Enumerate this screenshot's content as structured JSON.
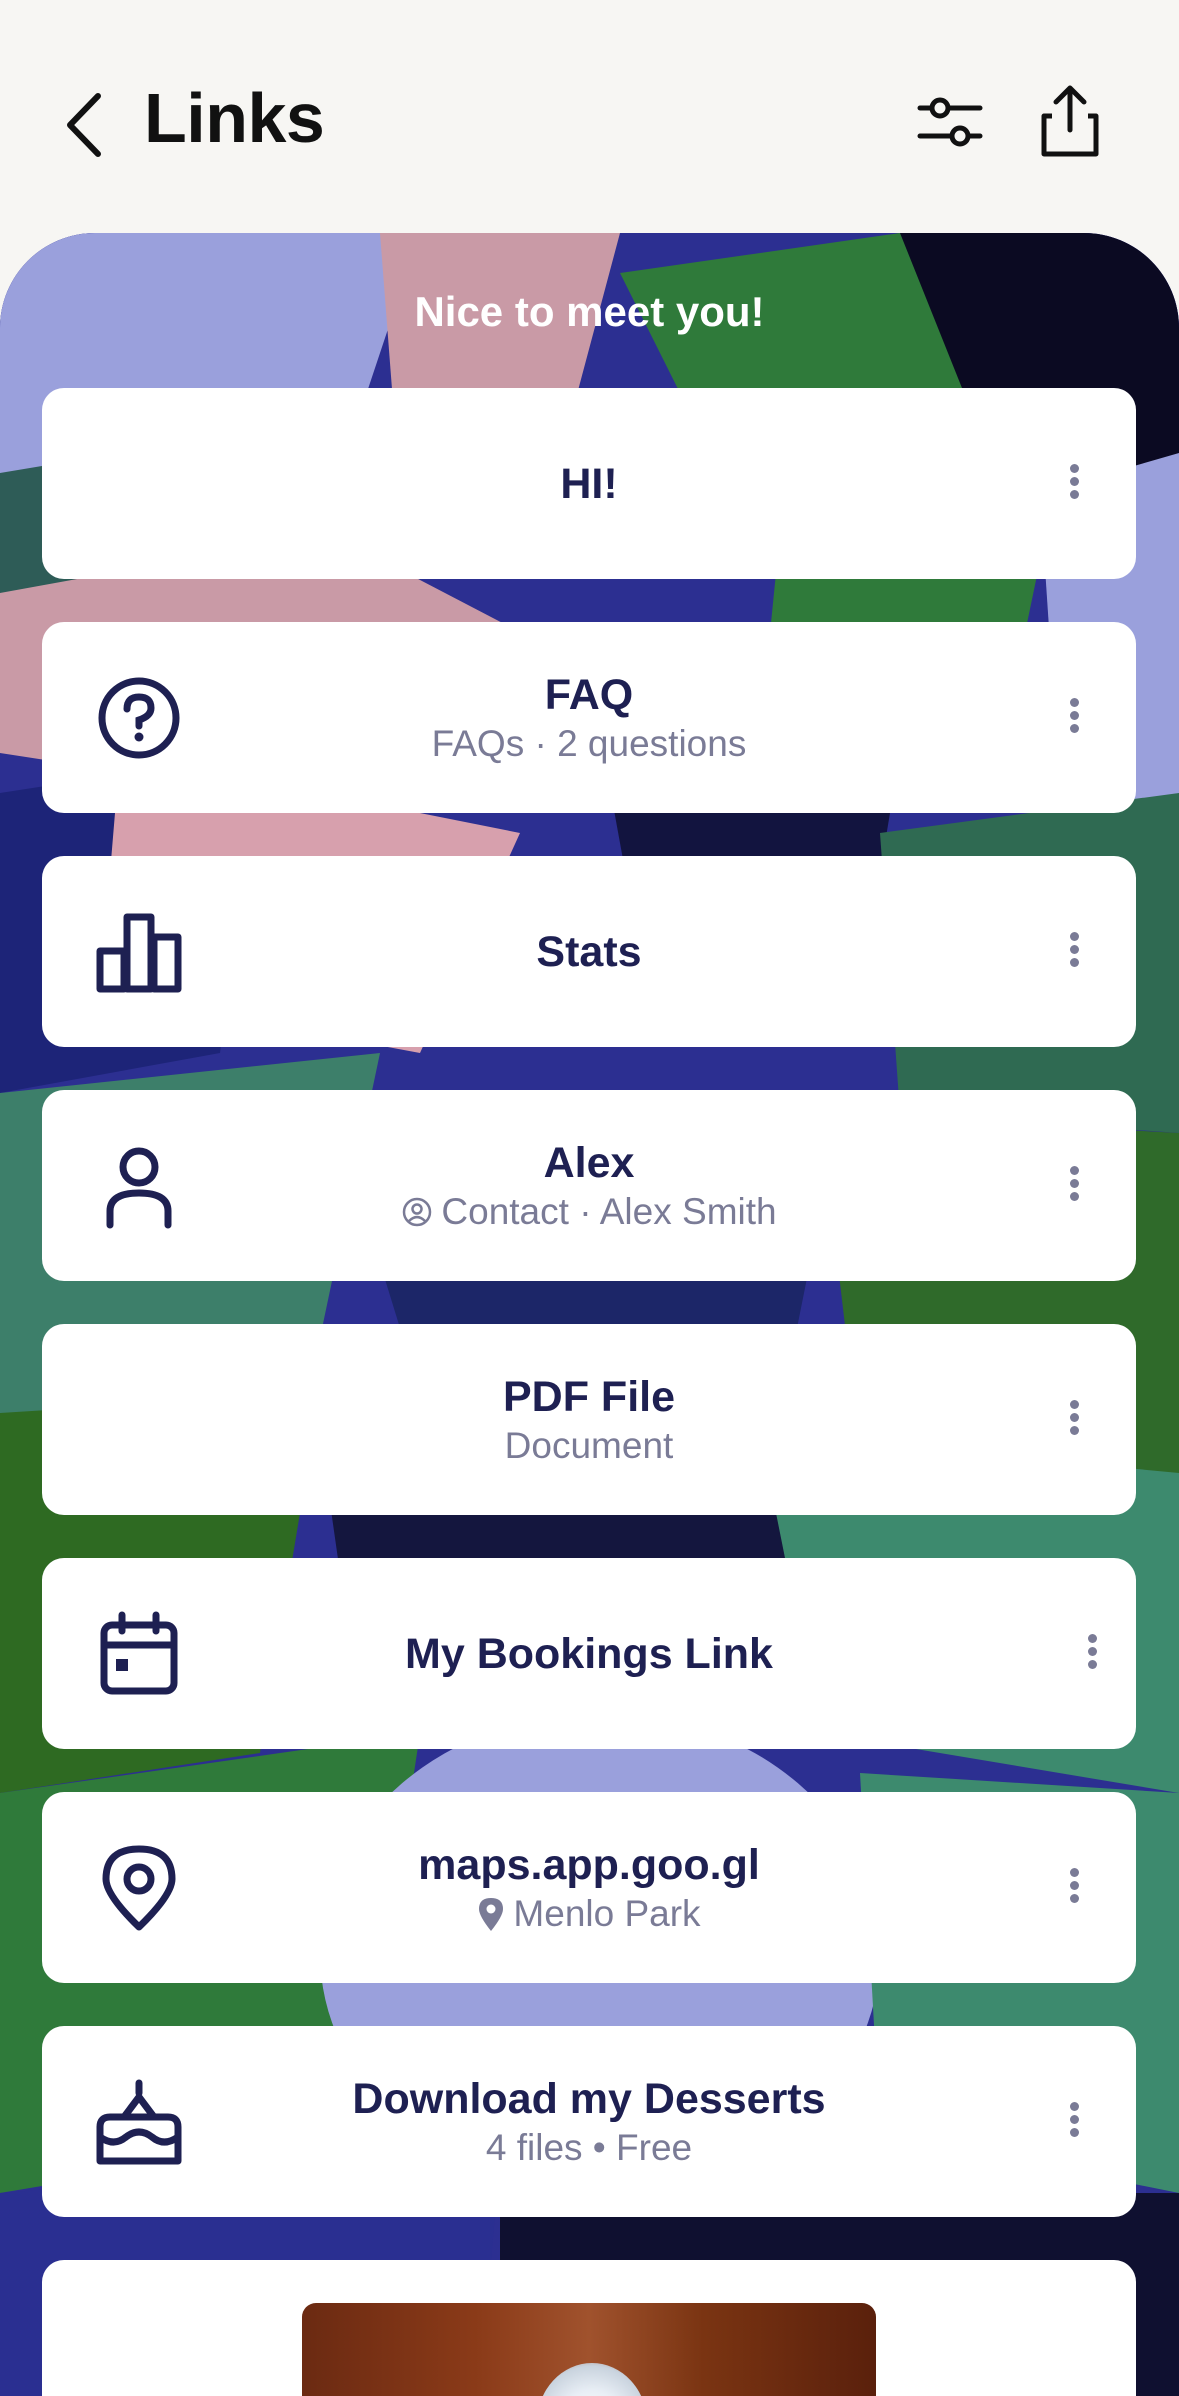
{
  "header": {
    "title": "Links",
    "back_icon": "chevron-left-icon",
    "filter_icon": "sliders-icon",
    "share_icon": "share-icon"
  },
  "greeting": "Nice to meet you!",
  "cards": [
    {
      "title": "HI!",
      "subtitle": "",
      "icon": null
    },
    {
      "title": "FAQ",
      "subtitle": "FAQs · 2 questions",
      "icon": "help-circle-icon"
    },
    {
      "title": "Stats",
      "subtitle": "",
      "icon": "bar-chart-icon"
    },
    {
      "title": "Alex",
      "subtitle": "Contact · Alex Smith",
      "subtitle_icon": "contact-icon",
      "icon": "person-icon"
    },
    {
      "title": "PDF File",
      "subtitle": "Document",
      "icon": null
    },
    {
      "title": "My Bookings Link",
      "subtitle": "",
      "icon": "calendar-icon"
    },
    {
      "title": "maps.app.goo.gl",
      "subtitle": "Menlo Park",
      "subtitle_icon": "map-pin-icon",
      "icon": "location-icon"
    },
    {
      "title": "Download my Desserts",
      "subtitle": "4 files • Free",
      "icon": "cake-icon"
    },
    {
      "title": "",
      "subtitle": "",
      "icon": "image-thumbnail"
    }
  ],
  "colors": {
    "text_primary": "#1e2052",
    "text_secondary": "#7a7b96",
    "background": "#f7f6f3"
  }
}
